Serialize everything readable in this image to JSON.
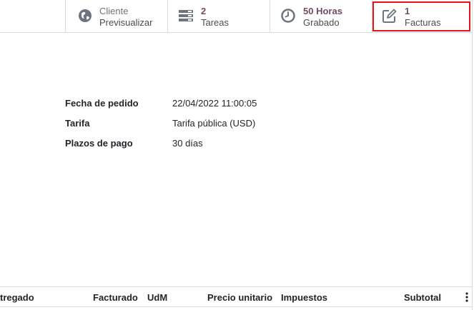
{
  "smart_buttons": [
    {
      "line1": "Cliente",
      "line2": "Previsualizar",
      "icon": "globe-icon"
    },
    {
      "line1": "2",
      "line2": "Tareas",
      "icon": "tasks-icon"
    },
    {
      "line1": "50 Horas",
      "line2": "Grabado",
      "icon": "clock-icon"
    },
    {
      "line1": "1",
      "line2": "Facturas",
      "icon": "pencil-square-icon"
    }
  ],
  "fields": [
    {
      "label": "Fecha de pedido",
      "value": "22/04/2022 11:00:05"
    },
    {
      "label": "Tarifa",
      "value": "Tarifa pública (USD)"
    },
    {
      "label": "Plazos de pago",
      "value": "30 días"
    }
  ],
  "table": {
    "columns": [
      "tregado",
      "Facturado",
      "UdM",
      "Precio unitario",
      "Impuestos",
      "Subtotal"
    ]
  },
  "colors": {
    "accent": "#714B67",
    "highlight": "#e8141c",
    "border": "#d8dadd"
  }
}
